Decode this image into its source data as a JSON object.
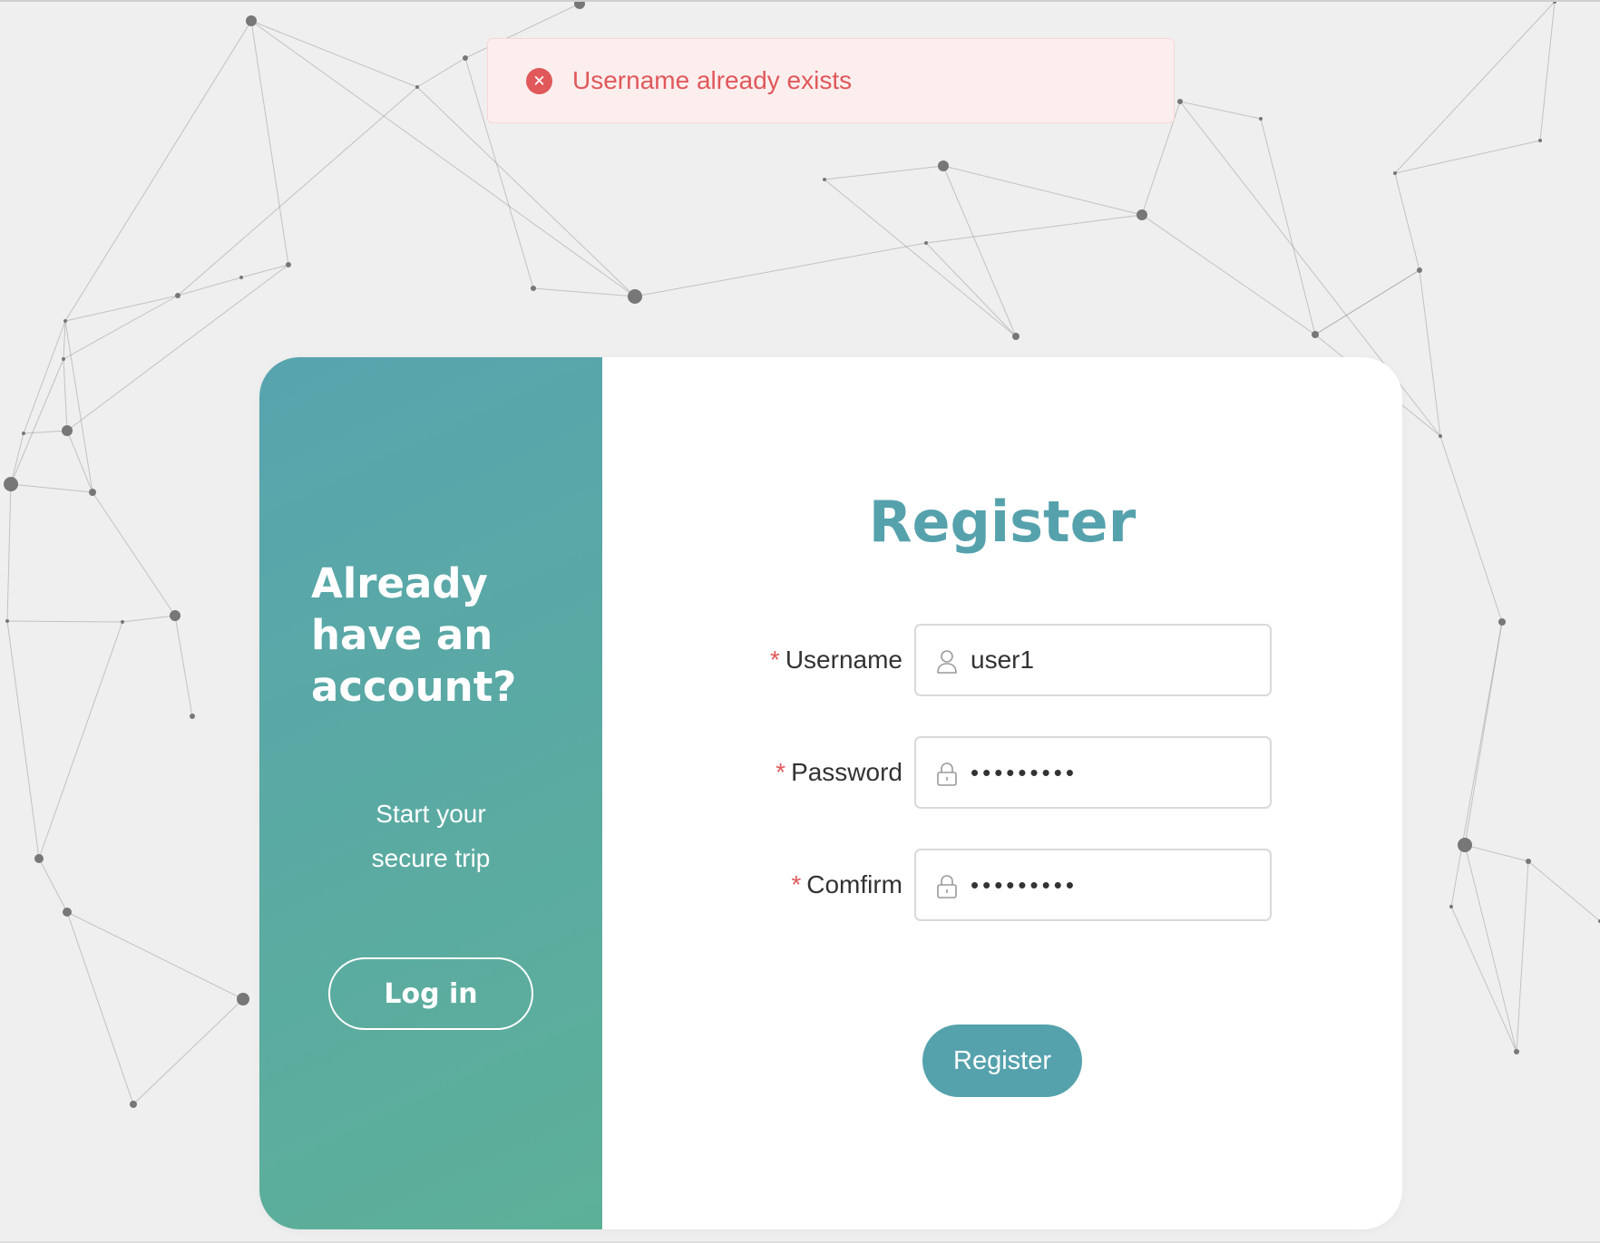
{
  "toast": {
    "message": "Username already exists",
    "icon": "error-circle-icon",
    "color": "#e0585a"
  },
  "left_panel": {
    "heading": "Already have an account?",
    "subtitle_line1": "Start your",
    "subtitle_line2": "secure trip",
    "login_label": "Log in",
    "gradient": [
      "#58a4ae",
      "#5db098"
    ]
  },
  "form": {
    "title": "Register",
    "required_mark": "*",
    "fields": [
      {
        "label": "Username",
        "icon": "user-icon",
        "value": "user1"
      },
      {
        "label": "Password",
        "icon": "lock-icon",
        "value": "•••••••••"
      },
      {
        "label": "Comfirm",
        "icon": "lock-icon",
        "value": "•••••••••"
      }
    ],
    "submit_label": "Register",
    "accent": "#55a2ad"
  }
}
